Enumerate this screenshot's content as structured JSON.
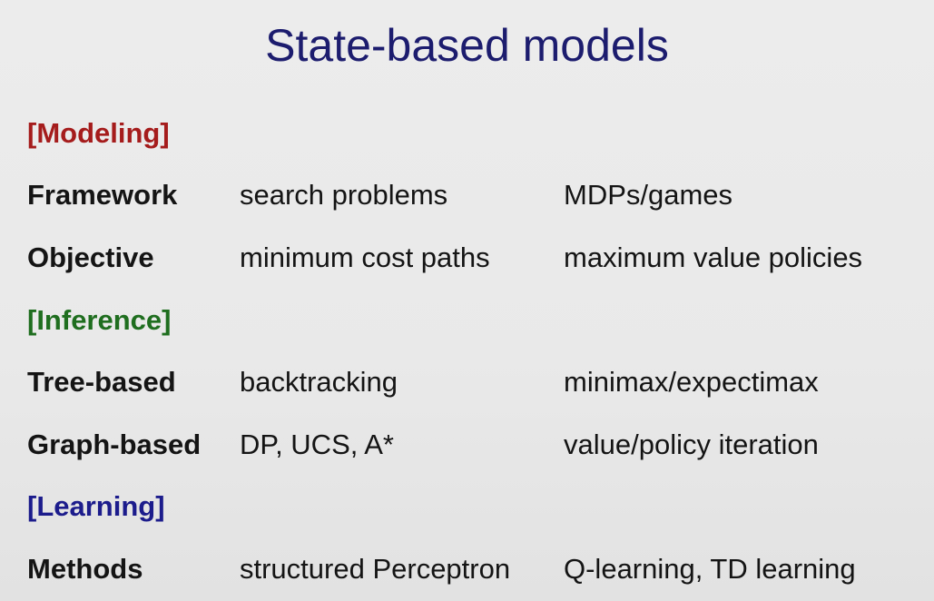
{
  "title": "State-based models",
  "colors": {
    "title": "#1c1c6e",
    "modeling": "#a51c1c",
    "inference": "#1f6e1f",
    "learning": "#1c1c8c",
    "text": "#141414",
    "background": "#ebebeb"
  },
  "sections": {
    "modeling": {
      "heading": "[Modeling]",
      "rows": [
        {
          "label": "Framework",
          "col1": "search problems",
          "col2": "MDPs/games"
        },
        {
          "label": "Objective",
          "col1": "minimum cost paths",
          "col2": "maximum value policies"
        }
      ]
    },
    "inference": {
      "heading": "[Inference]",
      "rows": [
        {
          "label": "Tree-based",
          "col1": "backtracking",
          "col2": "minimax/expectimax"
        },
        {
          "label": "Graph-based",
          "col1": "DP, UCS, A*",
          "col2": "value/policy iteration"
        }
      ]
    },
    "learning": {
      "heading": "[Learning]",
      "rows": [
        {
          "label": "Methods",
          "col1": "structured Perceptron",
          "col2": "Q-learning, TD learning"
        }
      ]
    }
  }
}
